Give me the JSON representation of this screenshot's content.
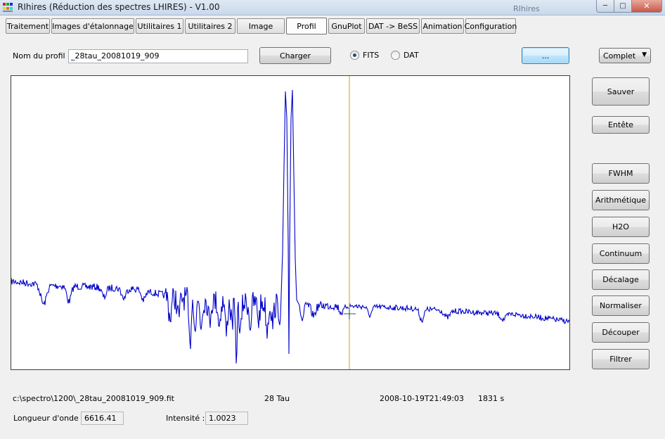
{
  "window": {
    "title": "RIhires (Réduction des spectres LHIRES) - V1.00",
    "background_title": "RIhires",
    "minimize_icon": "minimize-icon",
    "maximize_icon": "maximize-icon",
    "close_icon": "close-icon"
  },
  "tabs": [
    {
      "label": "Traitement",
      "active": false
    },
    {
      "label": "Images d'étalonnage",
      "active": false
    },
    {
      "label": "Utilitaires 1",
      "active": false
    },
    {
      "label": "Utilitaires 2",
      "active": false
    },
    {
      "label": "Image",
      "active": false
    },
    {
      "label": "Profil",
      "active": true
    },
    {
      "label": "GnuPlot",
      "active": false
    },
    {
      "label": "DAT -> BeSS",
      "active": false
    },
    {
      "label": "Animation",
      "active": false
    },
    {
      "label": "Configuration",
      "active": false
    }
  ],
  "profile": {
    "name_label": "Nom du profil :",
    "name_value": "_28tau_20081019_909",
    "load_button": "Charger",
    "format_fits": "FITS",
    "format_dat": "DAT",
    "selected_format": "FITS",
    "browse_button": "...",
    "mode_select": "Complet"
  },
  "side_buttons": {
    "save": "Sauver",
    "header": "Entête",
    "fwhm": "FWHM",
    "arithmetic": "Arithmétique",
    "h2o": "H2O",
    "continuum": "Continuum",
    "shift": "Décalage",
    "normalize": "Normaliser",
    "crop": "Découper",
    "filter": "Filtrer"
  },
  "status": {
    "file_path": "c:\\spectro\\1200\\_28tau_20081019_909.fit",
    "object": "28 Tau",
    "date": "2008-10-19T21:49:03",
    "exposure": "1831 s",
    "wavelength_label": "Longueur d'onde :",
    "wavelength_value": "6616.41",
    "intensity_label": "Intensité :",
    "intensity_value": "1.0023"
  },
  "colors": {
    "spectrum_line": "#0000c8",
    "cursor_line": "#e0b030",
    "crosshair": "#2a5a5a",
    "plot_background": "#ffffff"
  }
}
